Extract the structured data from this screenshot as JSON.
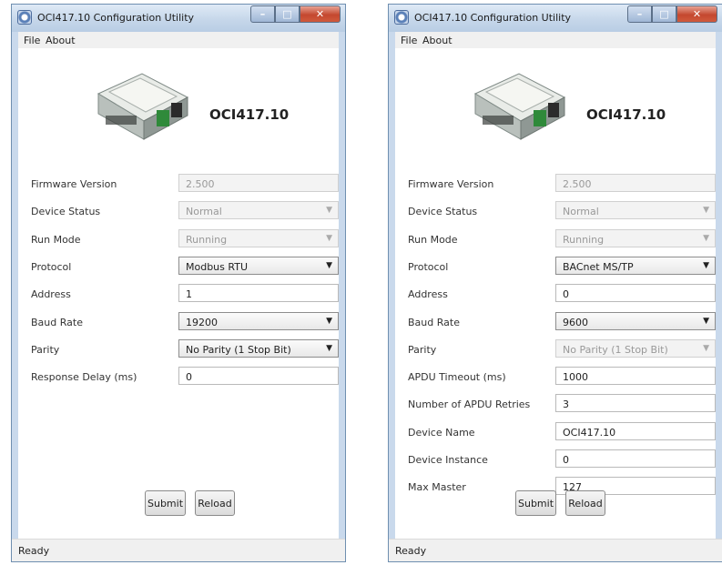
{
  "windows": [
    {
      "title": "OCI417.10 Configuration Utility",
      "menu": [
        "File",
        "About"
      ],
      "device_name": "OCI417.10",
      "fields": [
        {
          "label": "Firmware Version",
          "value": "2.500",
          "type": "text",
          "enabled": false
        },
        {
          "label": "Device Status",
          "value": "Normal",
          "type": "combo",
          "enabled": false
        },
        {
          "label": "Run Mode",
          "value": "Running",
          "type": "combo",
          "enabled": false
        },
        {
          "label": "Protocol",
          "value": "Modbus RTU",
          "type": "combo",
          "enabled": true
        },
        {
          "label": "Address",
          "value": "1",
          "type": "text",
          "enabled": true
        },
        {
          "label": "Baud Rate",
          "value": "19200",
          "type": "combo",
          "enabled": true
        },
        {
          "label": "Parity",
          "value": "No Parity (1 Stop Bit)",
          "type": "combo",
          "enabled": true
        },
        {
          "label": "Response Delay (ms)",
          "value": "0",
          "type": "text",
          "enabled": true
        }
      ],
      "submit_label": "Submit",
      "reload_label": "Reload",
      "status": "Ready"
    },
    {
      "title": "OCI417.10 Configuration Utility",
      "menu": [
        "File",
        "About"
      ],
      "device_name": "OCI417.10",
      "fields": [
        {
          "label": "Firmware Version",
          "value": "2.500",
          "type": "text",
          "enabled": false
        },
        {
          "label": "Device Status",
          "value": "Normal",
          "type": "combo",
          "enabled": false
        },
        {
          "label": "Run Mode",
          "value": "Running",
          "type": "combo",
          "enabled": false
        },
        {
          "label": "Protocol",
          "value": "BACnet MS/TP",
          "type": "combo",
          "enabled": true
        },
        {
          "label": "Address",
          "value": "0",
          "type": "text",
          "enabled": true
        },
        {
          "label": "Baud Rate",
          "value": "9600",
          "type": "combo",
          "enabled": true
        },
        {
          "label": "Parity",
          "value": "No Parity (1 Stop Bit)",
          "type": "combo",
          "enabled": false
        },
        {
          "label": "APDU Timeout (ms)",
          "value": "1000",
          "type": "text",
          "enabled": true
        },
        {
          "label": "Number of APDU Retries",
          "value": "3",
          "type": "text",
          "enabled": true
        },
        {
          "label": "Device Name",
          "value": "OCI417.10",
          "type": "text",
          "enabled": true
        },
        {
          "label": "Device Instance",
          "value": "0",
          "type": "text",
          "enabled": true
        },
        {
          "label": "Max Master",
          "value": "127",
          "type": "text",
          "enabled": true
        }
      ],
      "submit_label": "Submit",
      "reload_label": "Reload",
      "status": "Ready"
    }
  ],
  "icons": {
    "app": "app-gear-icon",
    "combo_arrow": "chevron-down-icon"
  },
  "colors": {
    "title_bar": "#c6d7ea",
    "close_button": "#c4482f",
    "disabled_text": "#999999"
  }
}
